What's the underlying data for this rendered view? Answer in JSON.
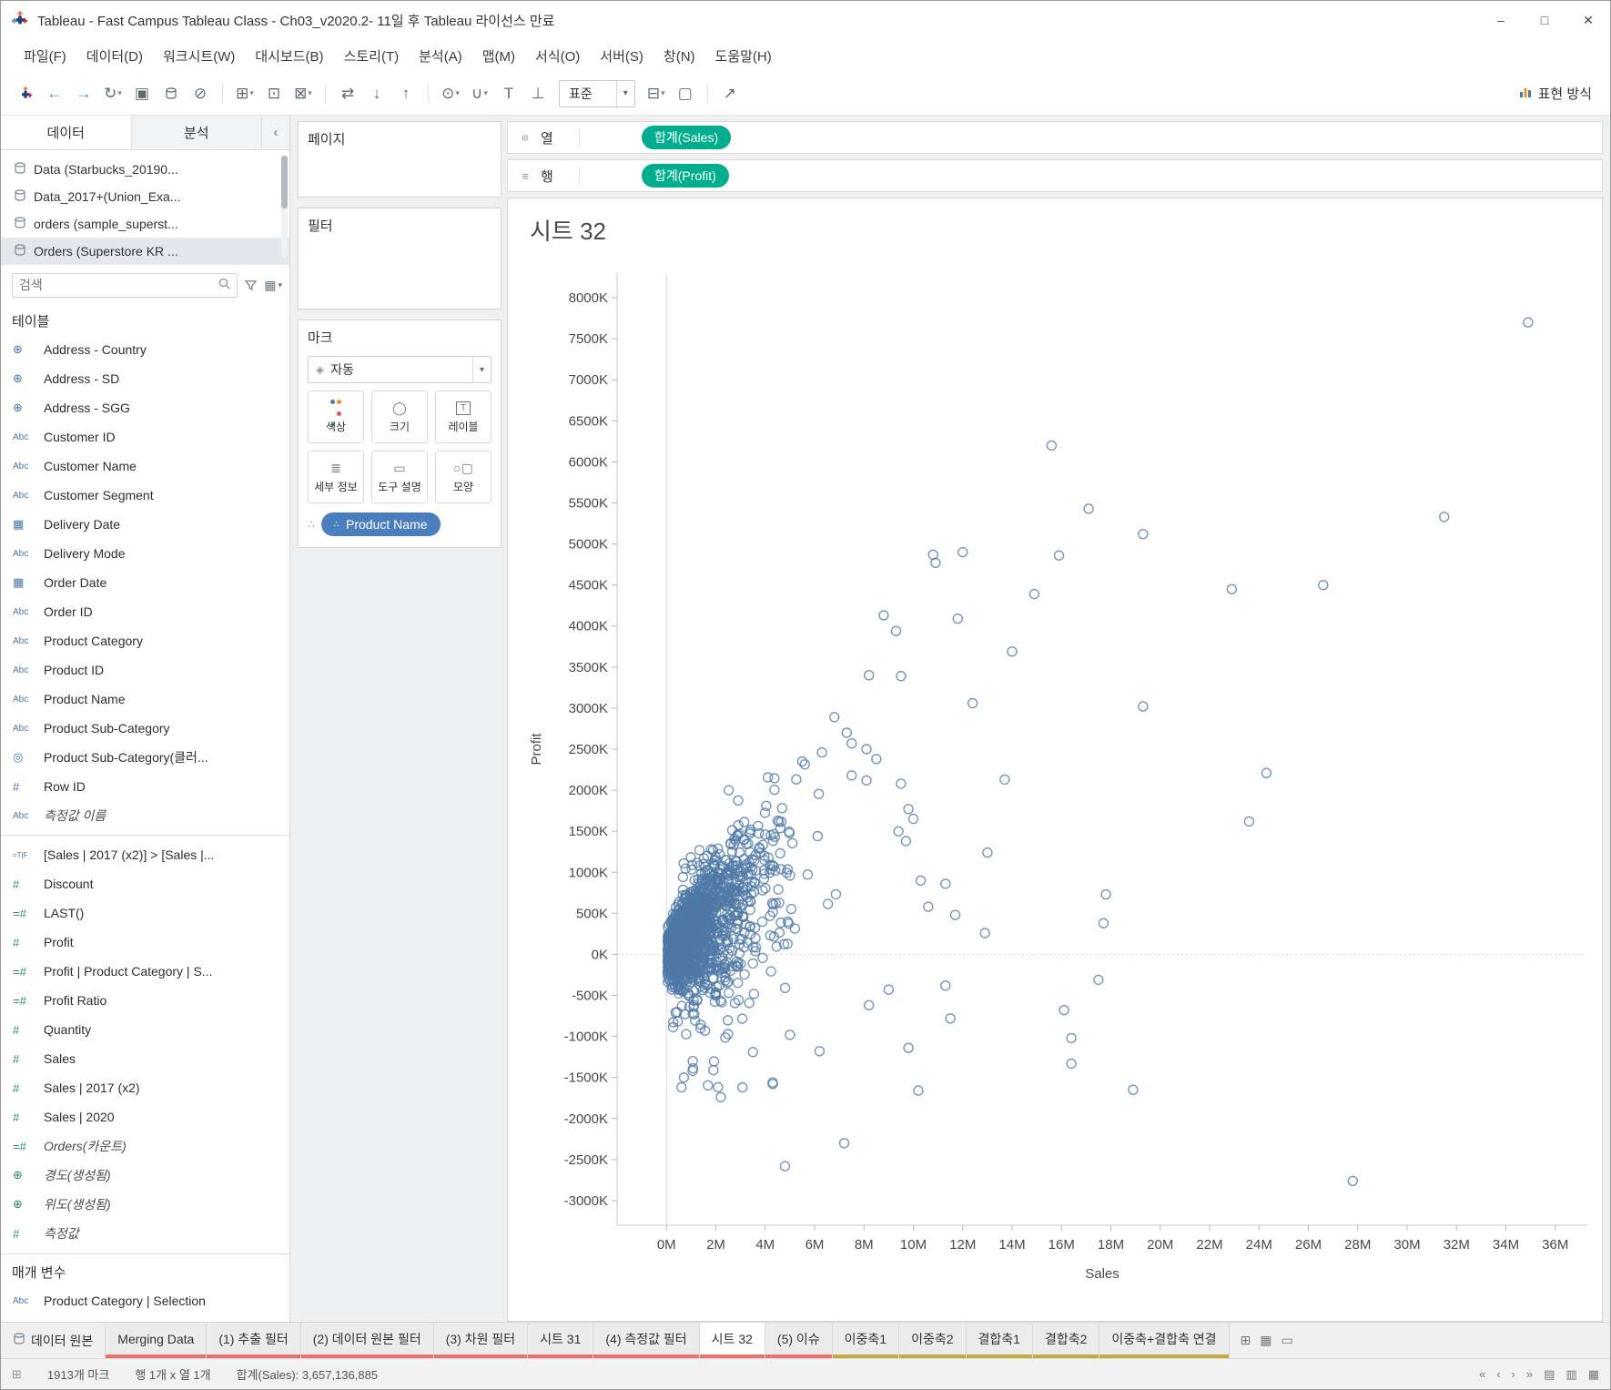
{
  "window": {
    "title": "Tableau - Fast Campus Tableau Class - Ch03_v2020.2- 11일 후 Tableau 라이선스 만료",
    "controls": {
      "minimize": "–",
      "maximize": "□",
      "close": "✕"
    }
  },
  "menubar": {
    "items": [
      "파일(F)",
      "데이터(D)",
      "워크시트(W)",
      "대시보드(B)",
      "스토리(T)",
      "분석(A)",
      "맵(M)",
      "서식(O)",
      "서버(S)",
      "창(N)",
      "도움말(H)"
    ]
  },
  "toolbar": {
    "fit_mode": "표준",
    "show_me": "표현 방식"
  },
  "data_pane": {
    "tabs": [
      {
        "label": "데이터",
        "active": true
      },
      {
        "label": "분석",
        "active": false
      }
    ],
    "sources": [
      {
        "label": "Data (Starbucks_20190...",
        "selected": false
      },
      {
        "label": "Data_2017+(Union_Exa...",
        "selected": false
      },
      {
        "label": "orders (sample_superst...",
        "selected": false
      },
      {
        "label": "Orders (Superstore KR ...",
        "selected": true
      }
    ],
    "search_placeholder": "검색",
    "tables_header": "테이블",
    "fields": [
      {
        "label": "Address - Country",
        "icon": "globe",
        "role": "dim"
      },
      {
        "label": "Address - SD",
        "icon": "globe",
        "role": "dim"
      },
      {
        "label": "Address - SGG",
        "icon": "globe",
        "role": "dim"
      },
      {
        "label": "Customer ID",
        "icon": "abc",
        "role": "dim"
      },
      {
        "label": "Customer Name",
        "icon": "abc",
        "role": "dim"
      },
      {
        "label": "Customer Segment",
        "icon": "abc",
        "role": "dim"
      },
      {
        "label": "Delivery Date",
        "icon": "calendar",
        "role": "dim"
      },
      {
        "label": "Delivery Mode",
        "icon": "abc",
        "role": "dim"
      },
      {
        "label": "Order Date",
        "icon": "calendar",
        "role": "dim"
      },
      {
        "label": "Order ID",
        "icon": "abc",
        "role": "dim"
      },
      {
        "label": "Product Category",
        "icon": "abc",
        "role": "dim"
      },
      {
        "label": "Product ID",
        "icon": "abc",
        "role": "dim"
      },
      {
        "label": "Product Name",
        "icon": "abc",
        "role": "dim"
      },
      {
        "label": "Product Sub-Category",
        "icon": "abc",
        "role": "dim"
      },
      {
        "label": "Product Sub-Category(클러...",
        "icon": "cluster",
        "role": "dim"
      },
      {
        "label": "Row ID",
        "icon": "hash",
        "role": "dim"
      },
      {
        "label": "측정값 이름",
        "icon": "abc",
        "role": "dim",
        "generated": true
      },
      {
        "divider": true
      },
      {
        "label": "[Sales | 2017 (x2)] > [Sales |...",
        "icon": "bool",
        "role": "dim"
      },
      {
        "label": "Discount",
        "icon": "hash",
        "role": "measure"
      },
      {
        "label": "LAST()",
        "icon": "calc-hash",
        "role": "measure"
      },
      {
        "label": "Profit",
        "icon": "hash",
        "role": "measure"
      },
      {
        "label": "Profit | Product Category | S...",
        "icon": "calc-hash",
        "role": "measure"
      },
      {
        "label": "Profit Ratio",
        "icon": "calc-hash",
        "role": "measure"
      },
      {
        "label": "Quantity",
        "icon": "hash",
        "role": "measure"
      },
      {
        "label": "Sales",
        "icon": "hash",
        "role": "measure"
      },
      {
        "label": "Sales | 2017 (x2)",
        "icon": "hash",
        "role": "measure"
      },
      {
        "label": "Sales | 2020",
        "icon": "hash",
        "role": "measure"
      },
      {
        "label": "Orders(카운트)",
        "icon": "calc-hash",
        "role": "measure",
        "generated": true
      },
      {
        "label": "경도(생성됨)",
        "icon": "globe",
        "role": "measure",
        "generated": true
      },
      {
        "label": "위도(생성됨)",
        "icon": "globe",
        "role": "measure",
        "generated": true
      },
      {
        "label": "측정값",
        "icon": "hash",
        "role": "measure",
        "generated": true
      }
    ],
    "parameters_header": "매개 변수",
    "parameters": [
      {
        "label": "Product Category | Selection",
        "icon": "abc",
        "role": "dim"
      }
    ]
  },
  "cards": {
    "pages_title": "페이지",
    "filters_title": "필터",
    "marks_title": "마크",
    "mark_type": "자동",
    "mark_buttons": [
      {
        "label": "색상",
        "icon": "color"
      },
      {
        "label": "크기",
        "icon": "size"
      },
      {
        "label": "레이블",
        "icon": "label"
      },
      {
        "label": "세부 정보",
        "icon": "detail"
      },
      {
        "label": "도구 설명",
        "icon": "tooltip"
      },
      {
        "label": "모양",
        "icon": "shape"
      }
    ],
    "shelf_pills": [
      {
        "label": "Product Name",
        "color": "blue"
      }
    ]
  },
  "shelves": {
    "columns_label": "열",
    "rows_label": "행",
    "columns_pills": [
      {
        "label": "합계(Sales)",
        "color": "green"
      }
    ],
    "rows_pills": [
      {
        "label": "합계(Profit)",
        "color": "green"
      }
    ]
  },
  "sheet": {
    "title": "시트 32"
  },
  "chart_data": {
    "type": "scatter",
    "title": "시트 32",
    "xlabel": "Sales",
    "ylabel": "Profit",
    "x_unit": "M",
    "y_unit": "K",
    "x_ticks_m": [
      0,
      2,
      4,
      6,
      8,
      10,
      12,
      14,
      16,
      18,
      20,
      22,
      24,
      26,
      28,
      30,
      32,
      34,
      36
    ],
    "y_ticks_k": [
      8000,
      7500,
      7000,
      6500,
      6000,
      5500,
      5000,
      4500,
      4000,
      3500,
      3000,
      2500,
      2000,
      1500,
      1000,
      500,
      0,
      -500,
      -1000,
      -1500,
      -2000,
      -2500,
      -3000
    ],
    "x_range_m": [
      -2.0,
      37.3
    ],
    "y_range_k": [
      -3300,
      8300
    ],
    "grid": "zero-lines-only",
    "legend": "none",
    "marks_count": 1913,
    "point_color": "#4E79A7",
    "outliers_m_k": [
      [
        34.9,
        7700
      ],
      [
        15.6,
        6200
      ],
      [
        17.1,
        5430
      ],
      [
        31.5,
        5330
      ],
      [
        19.3,
        5120
      ],
      [
        12.0,
        4900
      ],
      [
        10.8,
        4870
      ],
      [
        10.9,
        4770
      ],
      [
        15.9,
        4860
      ],
      [
        26.6,
        4500
      ],
      [
        22.9,
        4450
      ],
      [
        14.9,
        4390
      ],
      [
        11.8,
        4090
      ],
      [
        8.8,
        4130
      ],
      [
        9.3,
        3940
      ],
      [
        14.0,
        3690
      ],
      [
        12.4,
        3060
      ],
      [
        19.3,
        3020
      ],
      [
        24.3,
        2210
      ],
      [
        13.7,
        2130
      ],
      [
        23.6,
        1620
      ],
      [
        13.0,
        1240
      ],
      [
        17.8,
        730
      ],
      [
        17.5,
        -310
      ],
      [
        16.1,
        -680
      ],
      [
        16.4,
        -1020
      ],
      [
        16.4,
        -1330
      ],
      [
        9.8,
        -1140
      ],
      [
        10.2,
        -1660
      ],
      [
        18.9,
        -1650
      ],
      [
        27.8,
        -2760
      ],
      [
        4.8,
        -2580
      ],
      [
        7.2,
        -2300
      ],
      [
        11.5,
        -780
      ],
      [
        12.9,
        260
      ],
      [
        17.7,
        380
      ],
      [
        8.2,
        3400
      ],
      [
        9.5,
        3390
      ],
      [
        7.5,
        2570
      ],
      [
        8.1,
        2500
      ],
      [
        8.5,
        2380
      ],
      [
        5.5,
        2350
      ],
      [
        7.5,
        2180
      ],
      [
        8.1,
        2120
      ],
      [
        9.5,
        2080
      ],
      [
        9.8,
        1770
      ],
      [
        10.0,
        1650
      ],
      [
        9.4,
        1500
      ],
      [
        9.7,
        1380
      ],
      [
        10.3,
        900
      ],
      [
        11.3,
        860
      ],
      [
        10.6,
        580
      ],
      [
        11.7,
        480
      ],
      [
        11.3,
        -380
      ],
      [
        9.0,
        -430
      ],
      [
        8.2,
        -620
      ],
      [
        2.2,
        -1740
      ],
      [
        1.9,
        -1410
      ],
      [
        5.0,
        -980
      ],
      [
        6.2,
        -1180
      ],
      [
        4.3,
        -1560
      ],
      [
        3.5,
        -1190
      ],
      [
        6.8,
        2890
      ],
      [
        7.3,
        2700
      ],
      [
        6.3,
        2460
      ]
    ],
    "cluster_gen": {
      "seed": 20200311,
      "core": 950,
      "mid": 430,
      "fan": 180,
      "neg": 110
    }
  },
  "bottom_tabs": [
    {
      "label": "데이터 원본",
      "type": "datasource"
    },
    {
      "label": "Merging Data",
      "stripe": "red"
    },
    {
      "label": "(1) 추출 필터",
      "stripe": "red"
    },
    {
      "label": "(2) 데이터 원본 필터",
      "stripe": "red"
    },
    {
      "label": "(3) 차원 필터",
      "stripe": "red"
    },
    {
      "label": "시트 31",
      "stripe": "red"
    },
    {
      "label": "(4) 측정값 필터",
      "stripe": "red"
    },
    {
      "label": "시트 32",
      "stripe": "red",
      "active": true
    },
    {
      "label": "(5) 이슈",
      "stripe": "red"
    },
    {
      "label": "이중축1",
      "stripe": "yellow"
    },
    {
      "label": "이중축2",
      "stripe": "yellow"
    },
    {
      "label": "결합축1",
      "stripe": "yellow"
    },
    {
      "label": "결합축2",
      "stripe": "yellow"
    },
    {
      "label": "이중축+결합축 연결",
      "stripe": "yellow"
    }
  ],
  "status_bar": {
    "marks": "1913개 마크",
    "rows_cols": "행 1개 x 열 1개",
    "sum": "합계(Sales): 3,657,136,885"
  },
  "colors": {
    "pill_green": "#00AE8D",
    "pill_blue": "#4A7EBD",
    "stripe_red": "#E8736C",
    "stripe_yellow": "#C8A944",
    "point": "#4E79A7",
    "dim_icon": "#4E79A7",
    "measure_icon": "#2E8B74"
  }
}
